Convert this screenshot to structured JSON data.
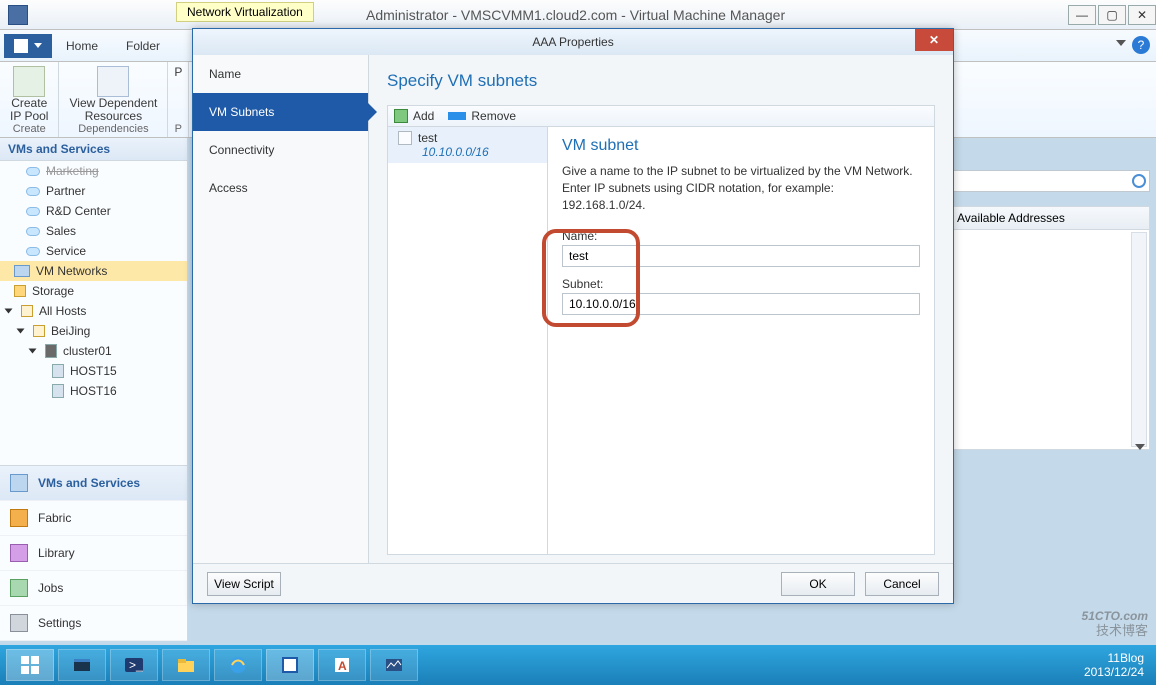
{
  "titlebar": {
    "hint": "Network Virtualization",
    "title": "Administrator - VMSCVMM1.cloud2.com - Virtual Machine Manager"
  },
  "ribbon_tabs": {
    "home": "Home",
    "folder": "Folder"
  },
  "ribbon": {
    "create_ip_pool": "Create\nIP Pool",
    "create_cap": "Create",
    "view_dep": "View Dependent\nResources",
    "dep_cap": "Dependencies",
    "p1": "P",
    "p2": "P"
  },
  "left": {
    "hdr": "VMs and Services",
    "items": [
      "Marketing",
      "Partner",
      "R&D Center",
      "Sales",
      "Service"
    ],
    "vmnet": "VM Networks",
    "storage": "Storage",
    "allhosts": "All Hosts",
    "beijing": "BeiJing",
    "cluster": "cluster01",
    "host15": "HOST15",
    "host16": "HOST16",
    "bottom": [
      "VMs and Services",
      "Fabric",
      "Library",
      "Jobs",
      "Settings"
    ]
  },
  "rightback": {
    "search_placeholder": "",
    "col": "Available Addresses"
  },
  "dialog": {
    "title": "AAA Properties",
    "nav": [
      "Name",
      "VM Subnets",
      "Connectivity",
      "Access"
    ],
    "heading": "Specify VM subnets",
    "add": "Add",
    "remove": "Remove",
    "list_name": "test",
    "list_sub": "10.10.0.0/16",
    "detail_title": "VM subnet",
    "detail_desc": "Give a name to the IP subnet to be virtualized by the VM Network. Enter IP subnets using CIDR notation, for example: 192.168.1.0/24.",
    "name_label": "Name:",
    "name_value": "test",
    "subnet_label": "Subnet:",
    "subnet_value": "10.10.0.0/16",
    "view_script": "View Script",
    "ok": "OK",
    "cancel": "Cancel"
  },
  "taskbar": {
    "time": "11Blog",
    "date": "2013/12/24"
  },
  "watermark": {
    "line1": "51CTO.com",
    "line2": "技术博客"
  }
}
